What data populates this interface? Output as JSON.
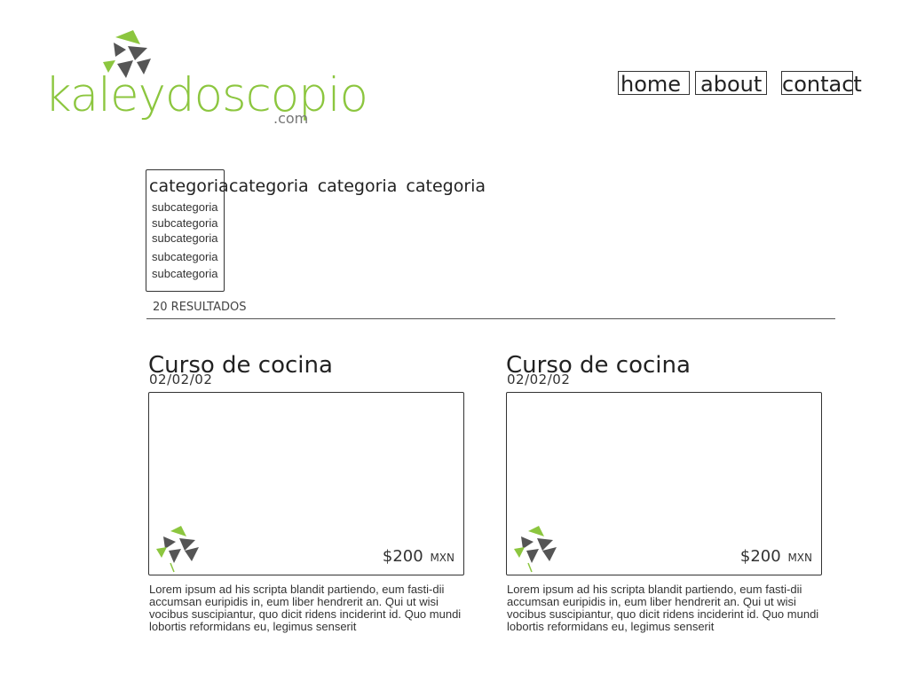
{
  "header": {
    "logo_text": "kaleydoscopio",
    "logo_suffix": ".com",
    "nav": {
      "home": "home",
      "about": "about",
      "contact": "contact"
    }
  },
  "categories": {
    "active": "categoria",
    "others": [
      "categoria",
      "categoria",
      "categoria"
    ],
    "subcategories": [
      "subcategoria",
      "subcategoria",
      "subcategoria",
      "subcategoria",
      "subcategoria"
    ]
  },
  "results_label": "20 RESULTADOS",
  "cards": [
    {
      "title": "Curso de cocina",
      "date": "02/02/02",
      "price": "$200",
      "currency": "MXN",
      "description": "Lorem ipsum ad his scripta blandit partiendo, eum fasti-dii accumsan euripidis in, eum liber hendrerit an. Qui ut wisi vocibus suscipiantur, quo dicit ridens inciderint id. Quo mundi lobortis reformidans eu, legimus senserit"
    },
    {
      "title": "Curso de cocina",
      "date": "02/02/02",
      "price": "$200",
      "currency": "MXN",
      "description": "Lorem ipsum ad his scripta blandit partiendo, eum fasti-dii accumsan euripidis in, eum liber hendrerit an. Qui ut wisi vocibus suscipiantur, quo dicit ridens inciderint id. Quo mundi lobortis reformidans eu, legimus senserit"
    }
  ],
  "colors": {
    "brand_green": "#8cc63f",
    "mark_gray": "#555555",
    "text": "#222222"
  }
}
